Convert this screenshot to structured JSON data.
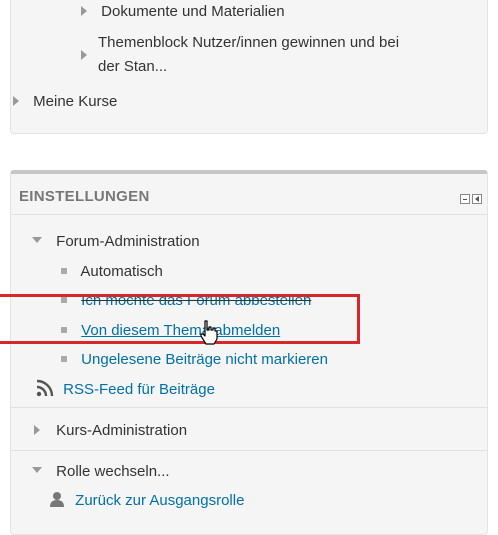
{
  "nav_block": {
    "items": [
      {
        "label": "Dokumente und Materialien"
      },
      {
        "label_line1": "Themenblock Nutzer/innen gewinnen und bei",
        "label_line2": "der Stan..."
      },
      {
        "label": "Meine Kurse"
      }
    ]
  },
  "settings_block": {
    "title": "EINSTELLUNGEN",
    "forum_admin": {
      "label": "Forum-Administration",
      "items": [
        {
          "label": "Automatisch",
          "link": false
        },
        {
          "label": "Ich möchte das Forum abbestellen",
          "link": true
        },
        {
          "label": "Von diesem Thema abmelden",
          "link": true
        },
        {
          "label": "Ungelesene Beiträge nicht markieren",
          "link": true
        }
      ],
      "rss": {
        "label": "RSS-Feed für Beiträge",
        "icon": "rss-icon"
      }
    },
    "kurs_admin": {
      "label": "Kurs-Administration"
    },
    "rolle": {
      "label": "Rolle wechseln...",
      "back": {
        "label": "Zurück zur Ausgangsrolle",
        "icon": "user-icon"
      }
    }
  },
  "colors": {
    "link": "#0070a8",
    "highlight_border": "#d62828",
    "text": "#333333"
  }
}
